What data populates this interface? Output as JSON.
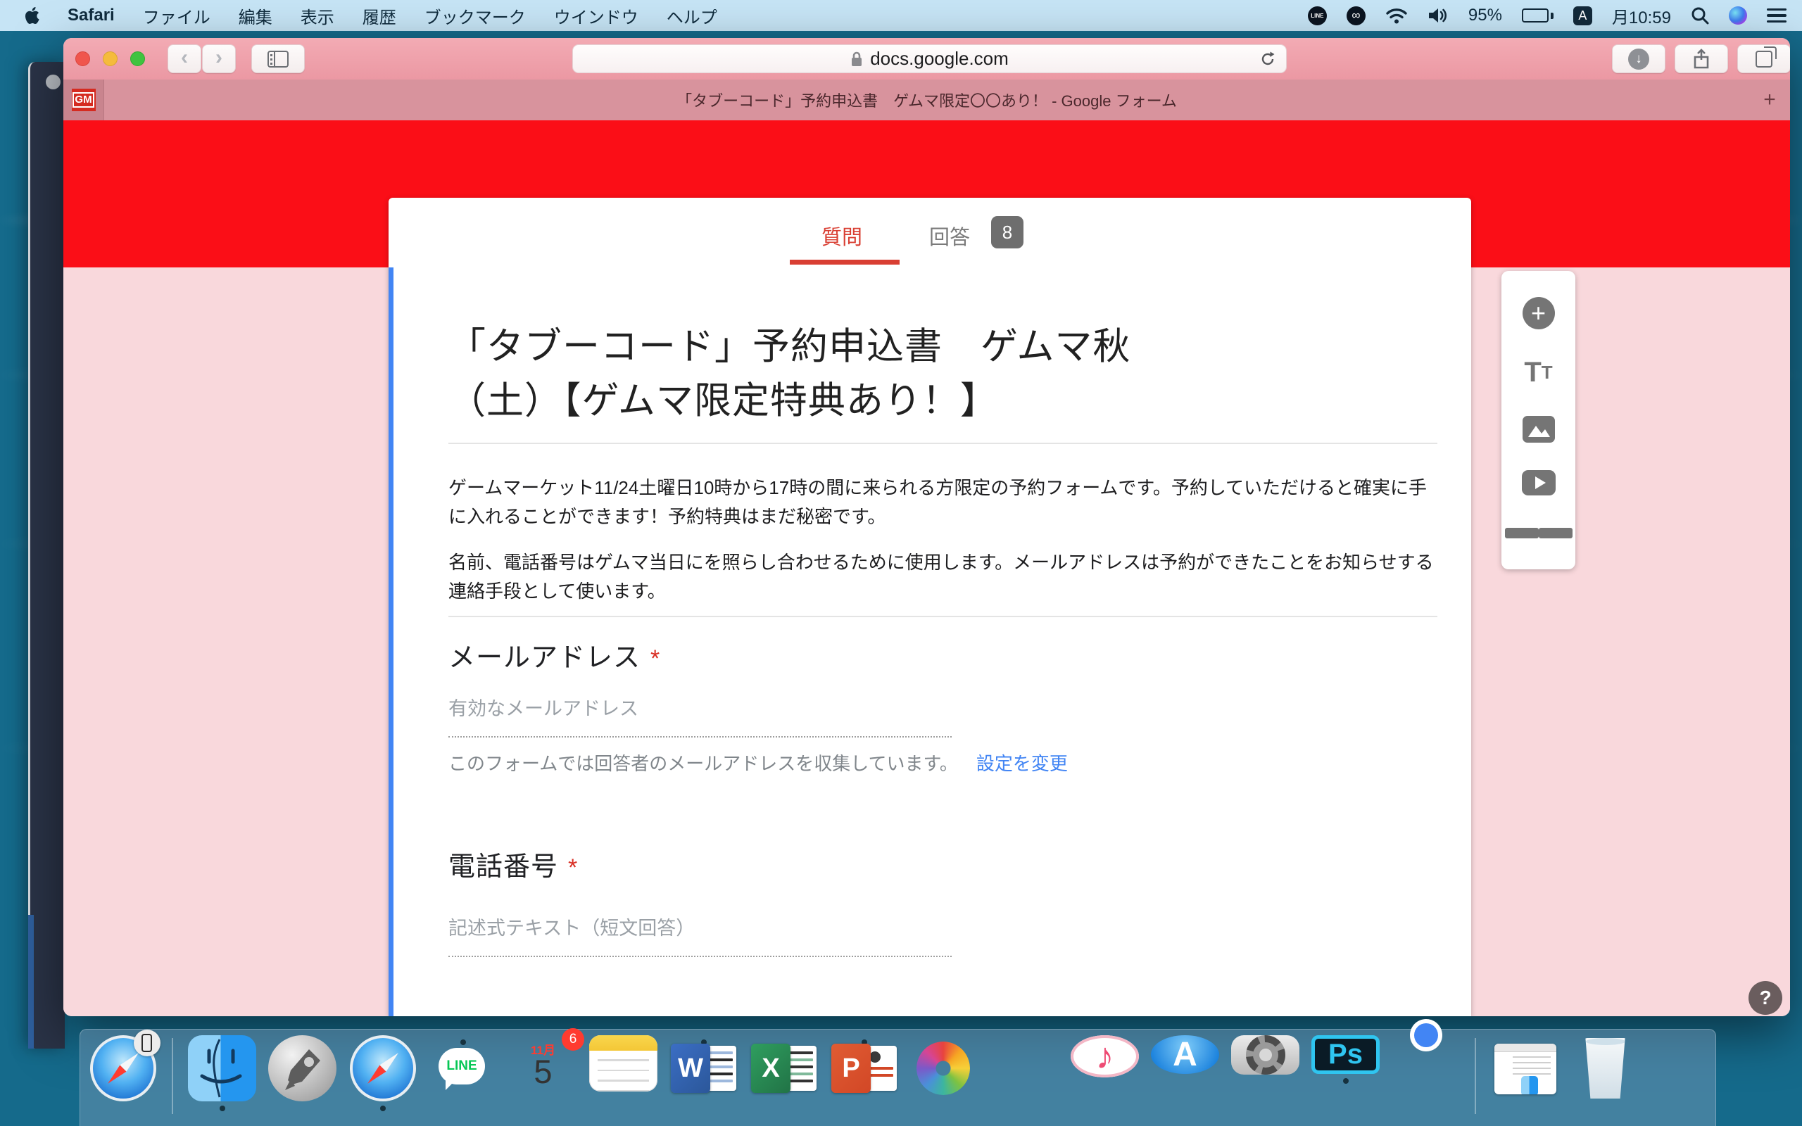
{
  "menu_bar": {
    "app_name": "Safari",
    "items": [
      "ファイル",
      "編集",
      "表示",
      "履歴",
      "ブックマーク",
      "ウインドウ",
      "ヘルプ"
    ],
    "status": {
      "line": "LINE",
      "cc": "∞",
      "battery": "95%",
      "ime": "A",
      "clock": "月10:59"
    }
  },
  "browser": {
    "url": "docs.google.com",
    "favicon": "GM",
    "tab_title": "「タブーコード」予約申込書　ゲムマ限定〇〇あり！ - Google フォーム",
    "new_tab": "+"
  },
  "form": {
    "tab_questions": "質問",
    "tab_responses": "回答",
    "responses_badge": "8",
    "title_line1": "「タブーコード」予約申込書　ゲムマ秋",
    "title_line2": "（土）【ゲムマ限定特典あり！】",
    "description1": "ゲームマーケット11/24土曜日10時から17時の間に来られる方限定の予約フォームです。予約していただけると確実に手に入れることができます！予約特典はまだ秘密です。",
    "description2": "名前、電話番号はゲムマ当日にを照らし合わせるために使用します。メールアドレスは予約ができたことをお知らせする連絡手段として使います。",
    "email_label": "メールアドレス",
    "email_required": "*",
    "email_placeholder": "有効なメールアドレス",
    "email_notice": "このフォームでは回答者のメールアドレスを収集しています。",
    "email_settings_link": "設定を変更",
    "phone_label": "電話番号",
    "phone_required": "*",
    "phone_placeholder": "記述式テキスト（短文回答）",
    "help": "?"
  },
  "dock": {
    "calendar_month": "11月",
    "calendar_day": "5",
    "calendar_badge": "6",
    "line_label": "LINE",
    "word": "W",
    "excel": "X",
    "powerpoint": "P",
    "photoshop": "Ps",
    "itunes_note": "♪",
    "appstore_letter": "A",
    "apps": [
      "handoff-safari",
      "finder",
      "launchpad",
      "safari",
      "line",
      "calendar",
      "notes",
      "word",
      "excel",
      "powerpoint",
      "photos",
      "imovie",
      "itunes",
      "app-store",
      "system-preferences",
      "photoshop",
      "chrome",
      "finder-window",
      "trash"
    ]
  },
  "colors": {
    "theme_red": "#fb0e17",
    "page_pink": "#f9d8dc",
    "accent_blue": "#4285f4",
    "tab_active_red": "#d93f33"
  }
}
